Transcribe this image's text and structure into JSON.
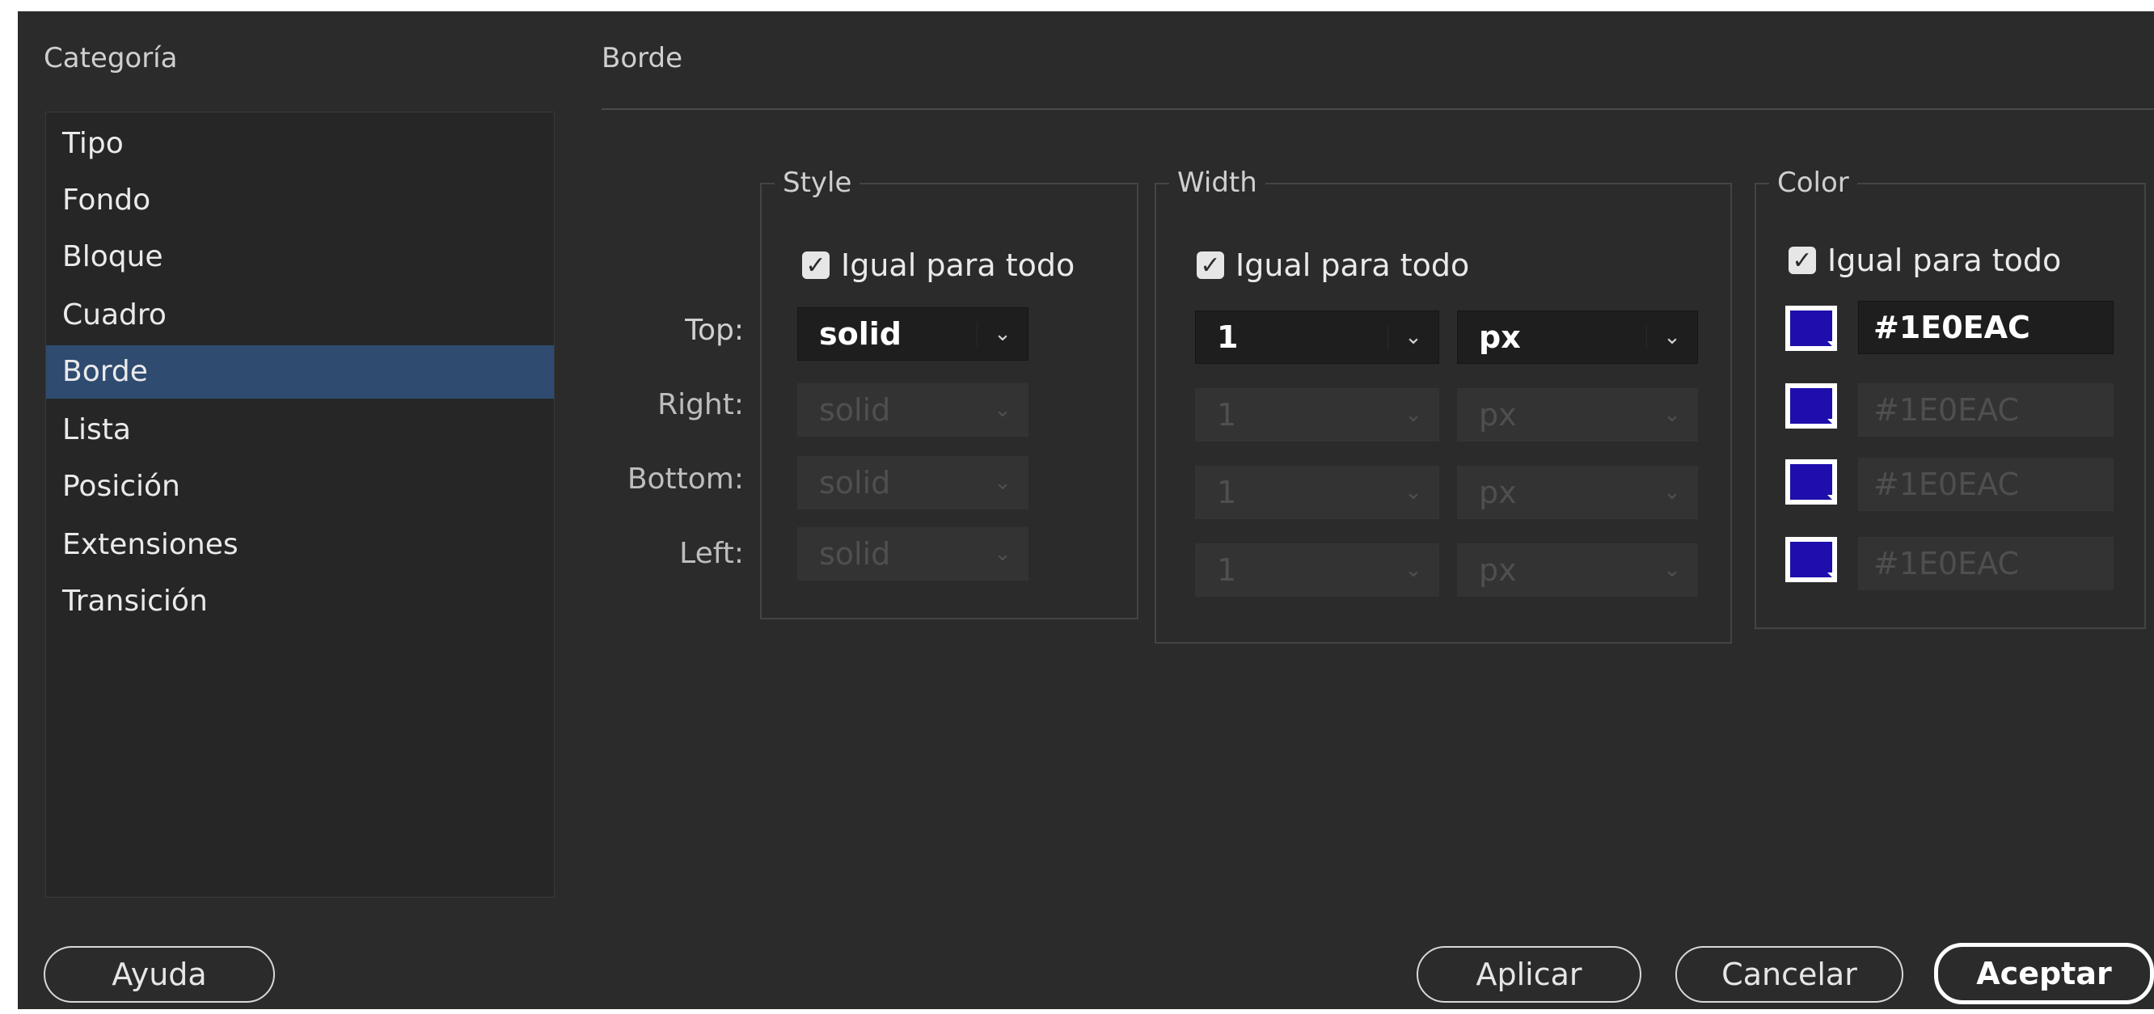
{
  "category_label": "Categoría",
  "categories": [
    {
      "label": "Tipo"
    },
    {
      "label": "Fondo"
    },
    {
      "label": "Bloque"
    },
    {
      "label": "Cuadro"
    },
    {
      "label": "Borde"
    },
    {
      "label": "Lista"
    },
    {
      "label": "Posición"
    },
    {
      "label": "Extensiones"
    },
    {
      "label": "Transición"
    }
  ],
  "selected_category": "Borde",
  "panel_title": "Borde",
  "groups": {
    "style": {
      "title": "Style",
      "same_label": "Igual para todo",
      "same_checked": true
    },
    "width": {
      "title": "Width",
      "same_label": "Igual para todo",
      "same_checked": true
    },
    "color": {
      "title": "Color",
      "same_label": "Igual para todo",
      "same_checked": true
    }
  },
  "sides": [
    {
      "label": "Top:",
      "style": "solid",
      "width": "1",
      "unit": "px",
      "color": "#1E0EAC",
      "enabled": true
    },
    {
      "label": "Right:",
      "style": "solid",
      "width": "1",
      "unit": "px",
      "color": "#1E0EAC",
      "enabled": false
    },
    {
      "label": "Bottom:",
      "style": "solid",
      "width": "1",
      "unit": "px",
      "color": "#1E0EAC",
      "enabled": false
    },
    {
      "label": "Left:",
      "style": "solid",
      "width": "1",
      "unit": "px",
      "color": "#1E0EAC",
      "enabled": false
    }
  ],
  "swatch_color": "#1E0EAC",
  "buttons": {
    "help": "Ayuda",
    "apply": "Aplicar",
    "cancel": "Cancelar",
    "ok": "Aceptar"
  },
  "checkmark_glyph": "✓",
  "caret_glyph": "⌄"
}
